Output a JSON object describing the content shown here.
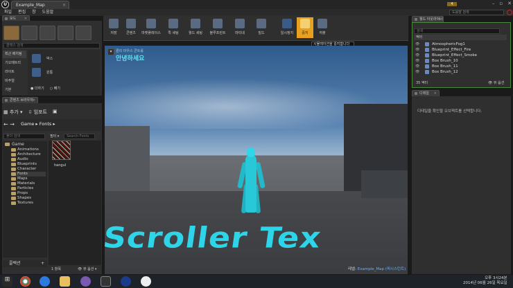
{
  "window": {
    "tab_title": "Example_Map",
    "search_help_placeholder": "도움말 검색"
  },
  "menu": [
    "파일",
    "편집",
    "창",
    "도움말"
  ],
  "modes": {
    "tab_label": "모드",
    "mode_label": "",
    "search_placeholder": "클래스 검색",
    "categories": [
      "최근 배치됨",
      "기오메트리",
      "라이트",
      "비주얼",
      "기본"
    ],
    "place_items": [
      "박스",
      "원통"
    ],
    "radio_add": "더하기",
    "radio_sub": "빼기"
  },
  "content_browser": {
    "tab_label": "콘텐츠 브라우저",
    "add_button": "추가",
    "import_button": "임포트",
    "save_icon": "save-icon",
    "path": [
      "Game",
      "Fonts"
    ],
    "source_search_placeholder": "폴더 검색",
    "filter_label": "필터",
    "asset_search_placeholder": "Search Fonts",
    "tree_root": "Game",
    "folders": [
      "Animations",
      "Architecture",
      "Audio",
      "Blueprints",
      "Character",
      "Fonts",
      "Maps",
      "Materials",
      "Particles",
      "Props",
      "Shapes",
      "Textures"
    ],
    "selected_folder": "Fonts",
    "asset_name": "hangul",
    "item_count": "1 항목",
    "view_options": "뷰 옵션",
    "collections_label": "콜렉션"
  },
  "toolbar": {
    "buttons": [
      "저장",
      "콘텐츠",
      "마켓플레이스",
      "퀵 세팅",
      "월드 세팅",
      "블루프린트",
      "마티네",
      "빌드",
      "일시정지",
      "중지",
      "꺼출"
    ],
    "tooltip": "시뮬레이션을 중지합니다"
  },
  "viewport": {
    "hello_small": "클리 마우스 콘트롤",
    "hello_text": "안녕하세요",
    "scroller_text": "Scroller Tex",
    "level_label": "레벨:",
    "level_name": "Example_Map",
    "level_suffix": "(퍼시스턴트)"
  },
  "outliner": {
    "tab_label": "월드 아웃라이너",
    "search_placeholder": "검색",
    "header": "액터",
    "rows": [
      "AtmosphericFog1",
      "Blueprint_Effect_Fire",
      "Blueprint_Effect_Smoke",
      "Box Brush_10",
      "Box Brush_11",
      "Box Brush_12"
    ],
    "count": "35 액터",
    "view_options": "뷰 옵션"
  },
  "details": {
    "tab_label": "디테일",
    "empty_message": "디테일을 확인할 오브젝트를 선택합니다."
  },
  "taskbar": {
    "time": "오후 3시24분",
    "date": "2014년 06월 26일 목요일"
  },
  "colors": {
    "accent_cyan": "#2ed5e8",
    "outliner_border": "#4a8a3a",
    "stop_button": "#e8a020"
  }
}
